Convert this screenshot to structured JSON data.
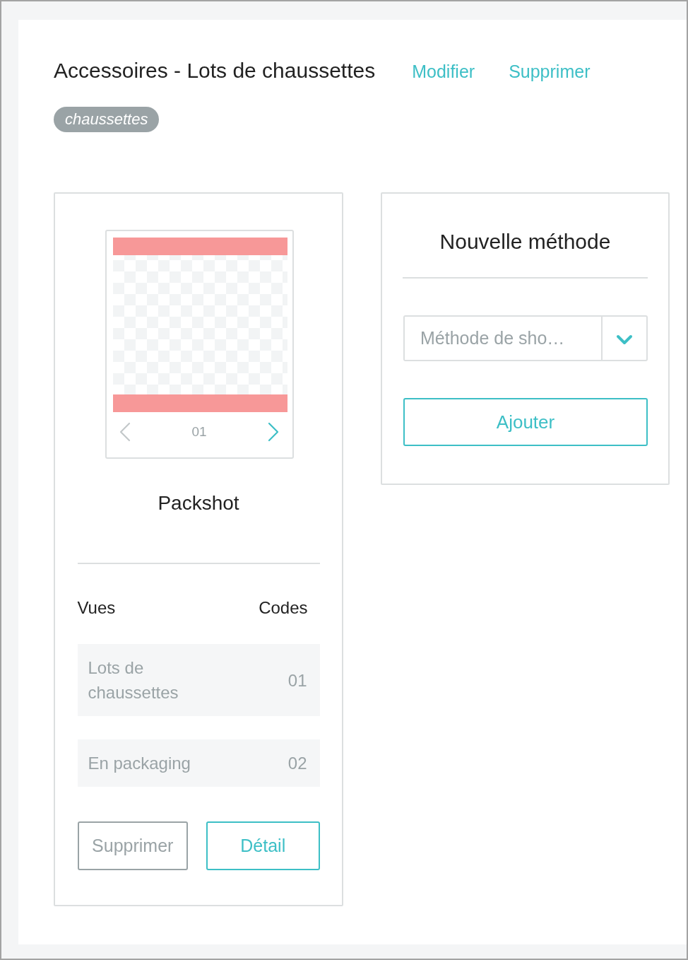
{
  "header": {
    "title": "Accessoires - Lots de chaussettes",
    "links": [
      "Modifier",
      "Supprimer"
    ],
    "tags": [
      "chaussettes"
    ]
  },
  "packshot_card": {
    "carousel": {
      "prev": {
        "disabled": true
      },
      "next": {
        "disabled": false
      },
      "counter": "01"
    },
    "title": "Packshot",
    "table": {
      "columns": [
        "Vues",
        "Codes"
      ],
      "rows": [
        {
          "view": "Lots de chaussettes",
          "code": "01"
        },
        {
          "view": "En packaging",
          "code": "02"
        }
      ]
    },
    "buttons": [
      {
        "label": "Supprimer",
        "kind": "secondary"
      },
      {
        "label": "Détail",
        "kind": "primary"
      }
    ]
  },
  "method_card": {
    "title": "Nouvelle méthode",
    "select": {
      "placeholder": "Méthode de sho…"
    },
    "button": {
      "label": "Ajouter"
    }
  }
}
